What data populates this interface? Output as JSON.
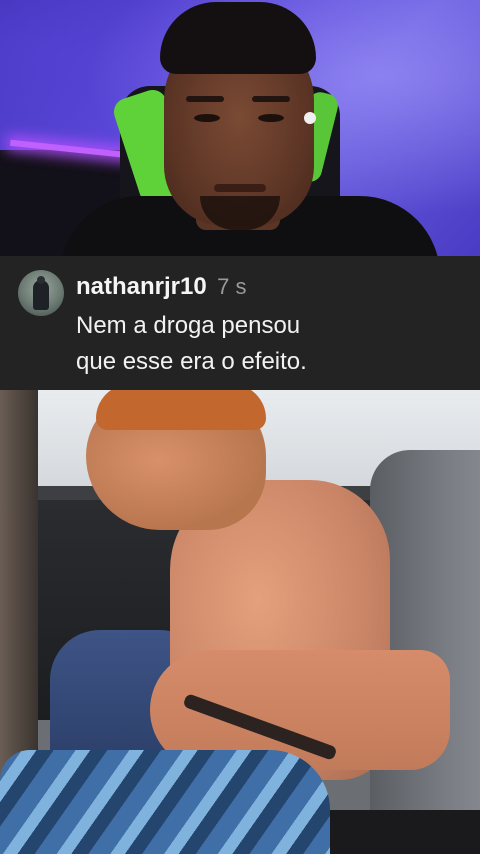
{
  "comment": {
    "username": "nathanrjr10",
    "time": "7 s",
    "text_line1": "Nem a droga pensou",
    "text_line2": "que esse era o efeito."
  },
  "icons": {
    "avatar": "profile-photo"
  },
  "colors": {
    "comment_background": "#232323",
    "username": "#f5f5f5",
    "timestamp": "#9a9a9a",
    "comment_text": "#f2f2f2"
  }
}
